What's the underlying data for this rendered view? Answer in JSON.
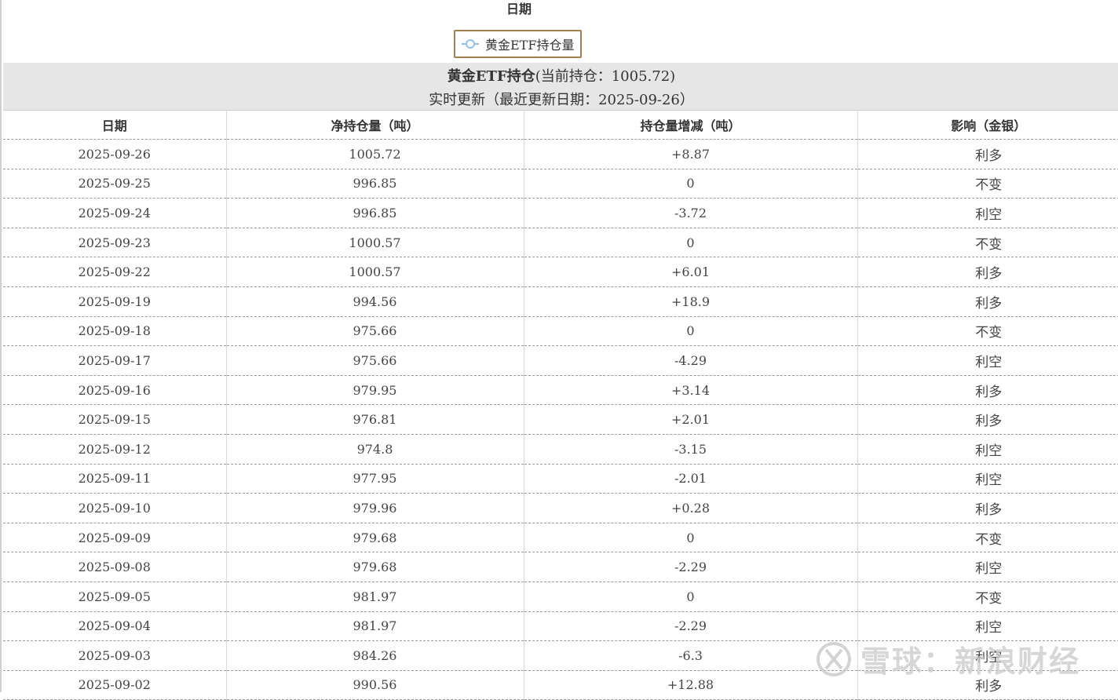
{
  "chart_axis_title": "日期",
  "legend": {
    "label": "黄金ETF持仓量",
    "icon": "line-series-icon"
  },
  "title": {
    "bold": "黄金ETF持仓",
    "rest": "(当前持仓：1005.72)",
    "subtitle": "实时更新（最近更新日期：2025-09-26）"
  },
  "table": {
    "headers": [
      "日期",
      "净持仓量（吨）",
      "持仓量增减（吨）",
      "影响（金银）"
    ],
    "rows": [
      [
        "2025-09-26",
        "1005.72",
        "+8.87",
        "利多"
      ],
      [
        "2025-09-25",
        "996.85",
        "0",
        "不变"
      ],
      [
        "2025-09-24",
        "996.85",
        "-3.72",
        "利空"
      ],
      [
        "2025-09-23",
        "1000.57",
        "0",
        "不变"
      ],
      [
        "2025-09-22",
        "1000.57",
        "+6.01",
        "利多"
      ],
      [
        "2025-09-19",
        "994.56",
        "+18.9",
        "利多"
      ],
      [
        "2025-09-18",
        "975.66",
        "0",
        "不变"
      ],
      [
        "2025-09-17",
        "975.66",
        "-4.29",
        "利空"
      ],
      [
        "2025-09-16",
        "979.95",
        "+3.14",
        "利多"
      ],
      [
        "2025-09-15",
        "976.81",
        "+2.01",
        "利多"
      ],
      [
        "2025-09-12",
        "974.8",
        "-3.15",
        "利空"
      ],
      [
        "2025-09-11",
        "977.95",
        "-2.01",
        "利空"
      ],
      [
        "2025-09-10",
        "979.96",
        "+0.28",
        "利多"
      ],
      [
        "2025-09-09",
        "979.68",
        "0",
        "不变"
      ],
      [
        "2025-09-08",
        "979.68",
        "-2.29",
        "利空"
      ],
      [
        "2025-09-05",
        "981.97",
        "0",
        "不变"
      ],
      [
        "2025-09-04",
        "981.97",
        "-2.29",
        "利空"
      ],
      [
        "2025-09-03",
        "984.26",
        "-6.3",
        "利空"
      ],
      [
        "2025-09-02",
        "990.56",
        "+12.88",
        "利多"
      ]
    ]
  },
  "watermark": {
    "text": "雪球：新浪财经",
    "icon": "xueqiu-logo-icon"
  },
  "colors": {
    "legend_border": "#a08050",
    "legend_line": "#8ec3e8",
    "band": "#e6e6e6"
  }
}
